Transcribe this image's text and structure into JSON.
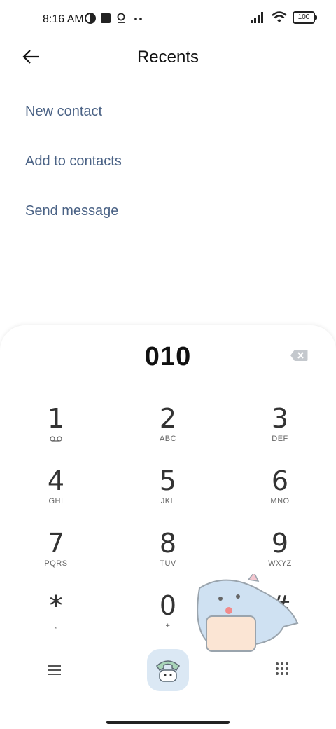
{
  "status": {
    "time": "8:16 AM",
    "battery": "100"
  },
  "header": {
    "title": "Recents"
  },
  "menu": {
    "items": [
      "New contact",
      "Add to contacts",
      "Send message"
    ]
  },
  "dialer": {
    "number": "010",
    "keys": [
      {
        "digit": "1",
        "letters": ""
      },
      {
        "digit": "2",
        "letters": "ABC"
      },
      {
        "digit": "3",
        "letters": "DEF"
      },
      {
        "digit": "4",
        "letters": "GHI"
      },
      {
        "digit": "5",
        "letters": "JKL"
      },
      {
        "digit": "6",
        "letters": "MNO"
      },
      {
        "digit": "7",
        "letters": "PQRS"
      },
      {
        "digit": "8",
        "letters": "TUV"
      },
      {
        "digit": "9",
        "letters": "WXYZ"
      },
      {
        "digit": "*",
        "letters": ","
      },
      {
        "digit": "0",
        "letters": "+"
      },
      {
        "digit": "#",
        "letters": ""
      }
    ]
  },
  "colors": {
    "menu_text": "#4a6285",
    "call_button": "#dbe8f4"
  },
  "icons": [
    "back-arrow-icon",
    "backspace-icon",
    "voicemail-icon",
    "menu-icon",
    "call-icon",
    "dialpad-toggle-icon"
  ]
}
